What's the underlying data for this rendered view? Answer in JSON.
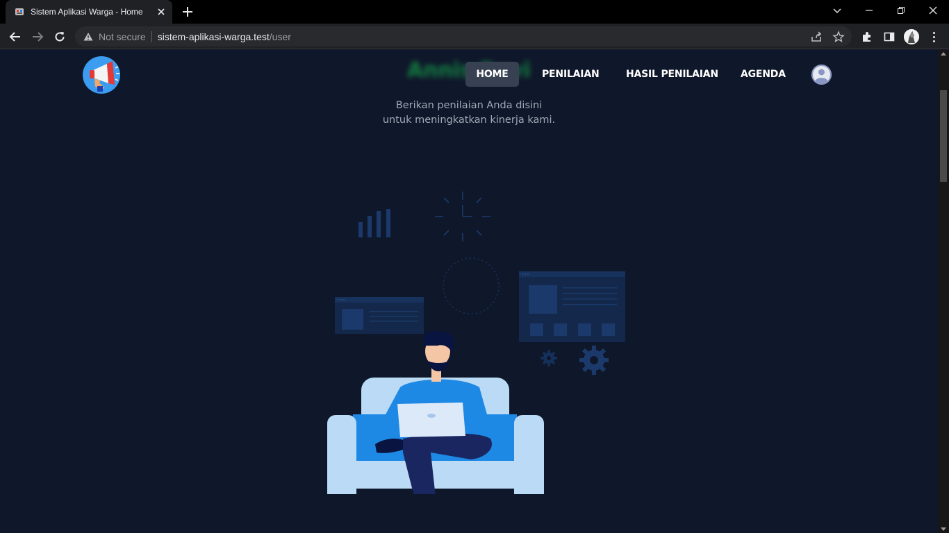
{
  "browser": {
    "tab_title": "Sistem Aplikasi Warga - Home",
    "security_label": "Not secure",
    "url_host": "sistem-aplikasi-warga.test",
    "url_path": "/user"
  },
  "site": {
    "brand_name": "Annis Ravi",
    "nav": [
      {
        "label": "HOME",
        "active": true
      },
      {
        "label": "PENILAIAN",
        "active": false
      },
      {
        "label": "HASIL PENILAIAN",
        "active": false
      },
      {
        "label": "AGENDA",
        "active": false
      }
    ],
    "tagline_line1": "Berikan penilaian Anda disini",
    "tagline_line2": "untuk meningkatkan kinerja kami."
  },
  "colors": {
    "page_bg": "#0f172a",
    "nav_active_bg": "#374151",
    "accent_blue": "#1e88e5",
    "sofa": "#bbdaf5"
  },
  "icons": {
    "logo": "megaphone-icon",
    "user": "user-avatar-icon"
  }
}
